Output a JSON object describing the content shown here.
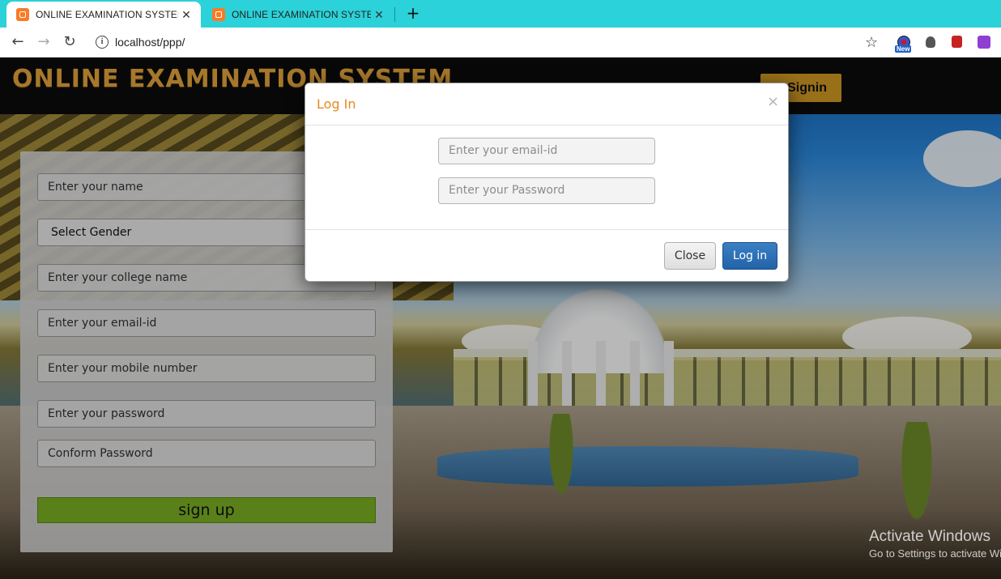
{
  "browser": {
    "tabs": [
      {
        "title": "ONLINE EXAMINATION SYSTEM",
        "close": "✕",
        "active": true
      },
      {
        "title": "ONLINE EXAMINATION SYSTEM",
        "close": "✕",
        "active": false
      }
    ],
    "new_tab": "+",
    "url": "localhost/ppp/",
    "extension_badge": "New"
  },
  "header": {
    "site_title": "ONLINE EXAMINATION SYSTEM",
    "signin_label": "Signin"
  },
  "signup_form": {
    "name_placeholder": "Enter your name",
    "gender_select": "Select Gender",
    "college_placeholder": "Enter your college name",
    "email_placeholder": "Enter your email-id",
    "mobile_placeholder": "Enter your mobile number",
    "password_placeholder": "Enter your password",
    "confirm_placeholder": "Conform Password",
    "submit_label": "sign up"
  },
  "login_modal": {
    "title": "Log In",
    "close_x": "×",
    "email_placeholder": "Enter your email-id",
    "password_placeholder": "Enter your Password",
    "close_label": "Close",
    "login_label": "Log in"
  },
  "watermark": {
    "title": "Activate Windows",
    "subtitle": "Go to Settings to activate Windows."
  },
  "colors": {
    "tabbar": "#2bd2d9",
    "title_orange": "#e8a73d",
    "signin_gold": "#d49b24",
    "signup_green": "#7db223",
    "modal_title": "#e58a1f",
    "login_blue": "#2363a8"
  }
}
